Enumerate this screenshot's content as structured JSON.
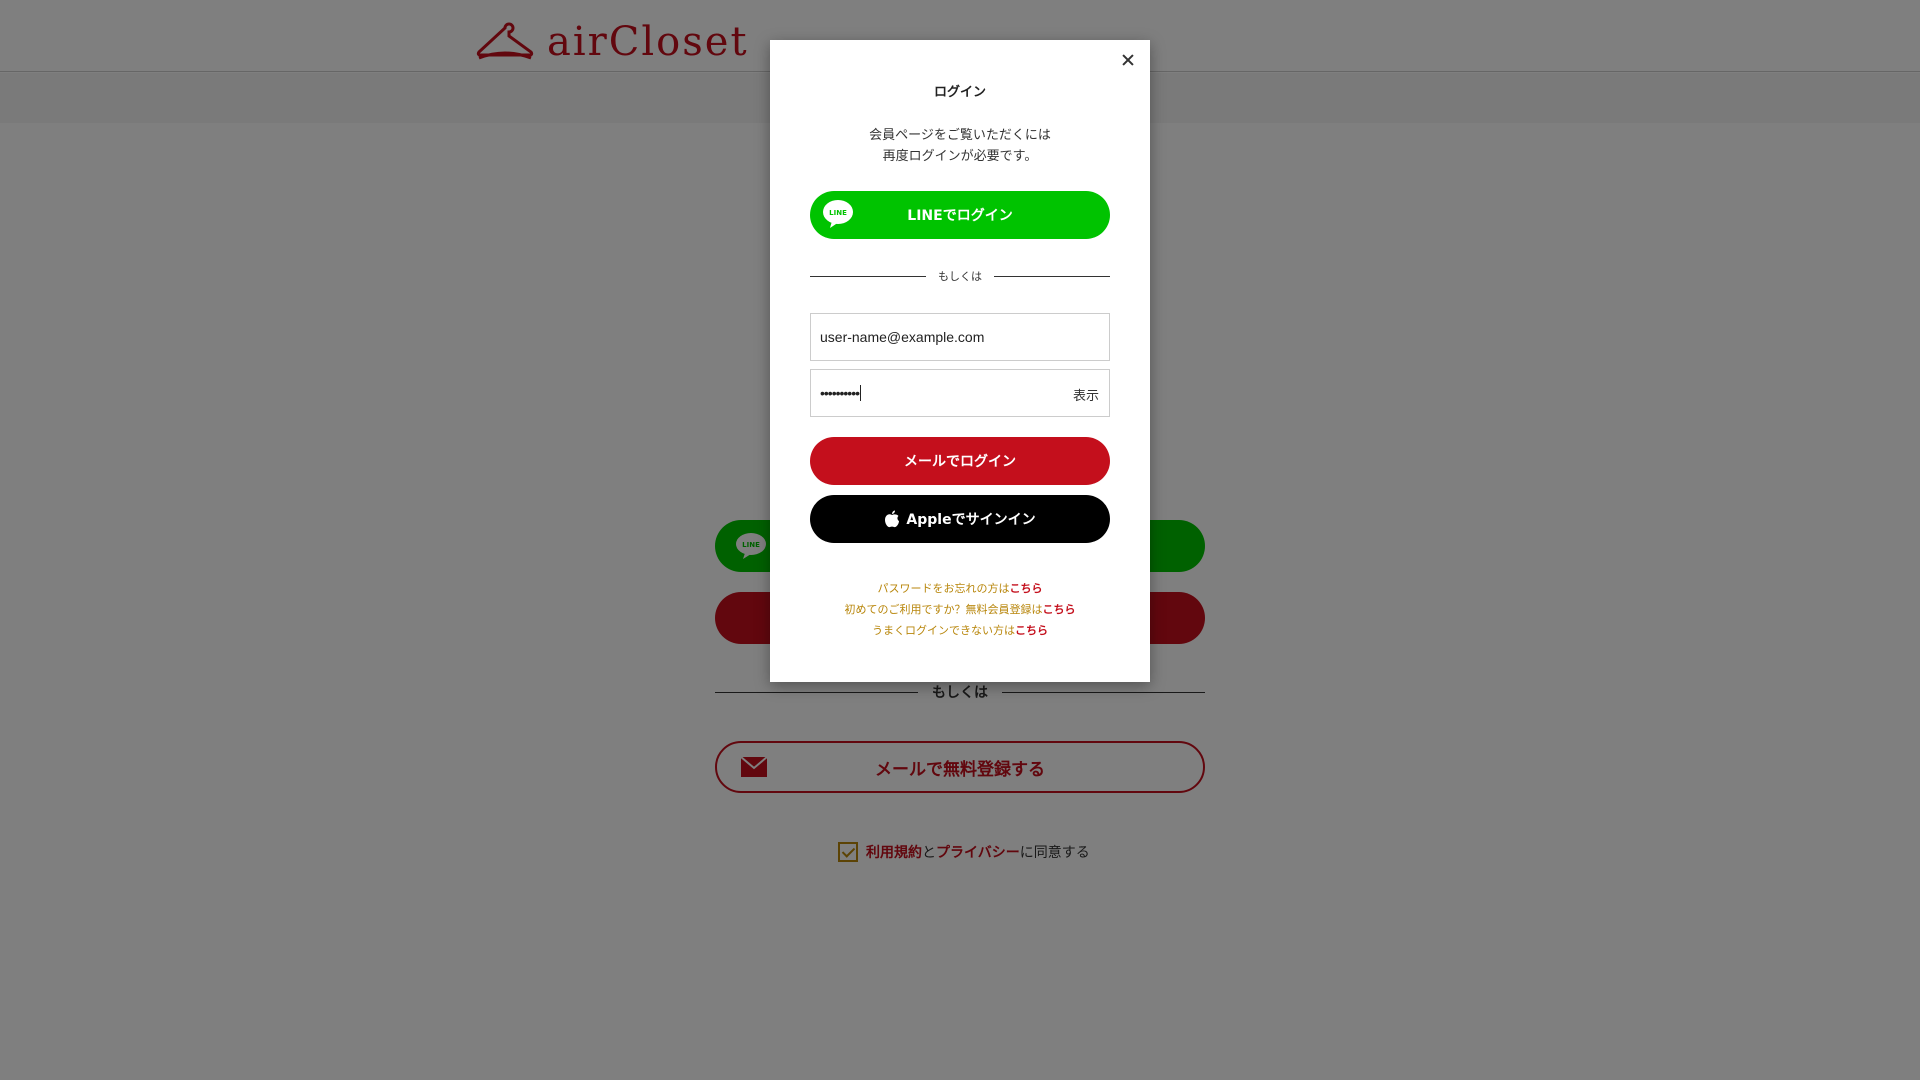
{
  "header": {
    "logo_text": "airCloset",
    "brand_color": "#c40f1c"
  },
  "background": {
    "divider_text": "もしくは",
    "mail_register_label": "メールで無料登録する",
    "agree": {
      "terms": "利用規約",
      "and": "と",
      "privacy": "プライバシー",
      "suffix": "に同意する"
    }
  },
  "modal": {
    "title": "ログイン",
    "description_line1": "会員ページをご覧いただくには",
    "description_line2": "再度ログインが必要です。",
    "line_button_label": "LINEでログイン",
    "divider_text": "もしくは",
    "email_value": "user-name@example.com",
    "password_masked": "••••••••••",
    "show_password_label": "表示",
    "mail_login_label": "メールでログイン",
    "apple_signin_label": "Appleでサインイン",
    "links": {
      "forgot_prefix": "パスワードをお忘れの方は",
      "first_time_prefix": "初めてのご利用ですか？無料会員登録は",
      "trouble_prefix": "うまくログインできない方は",
      "here": "こちら"
    }
  },
  "colors": {
    "line_green": "#00c300",
    "brand_red": "#c40f1c",
    "apple_black": "#000000",
    "link_gold": "#b8860b"
  }
}
